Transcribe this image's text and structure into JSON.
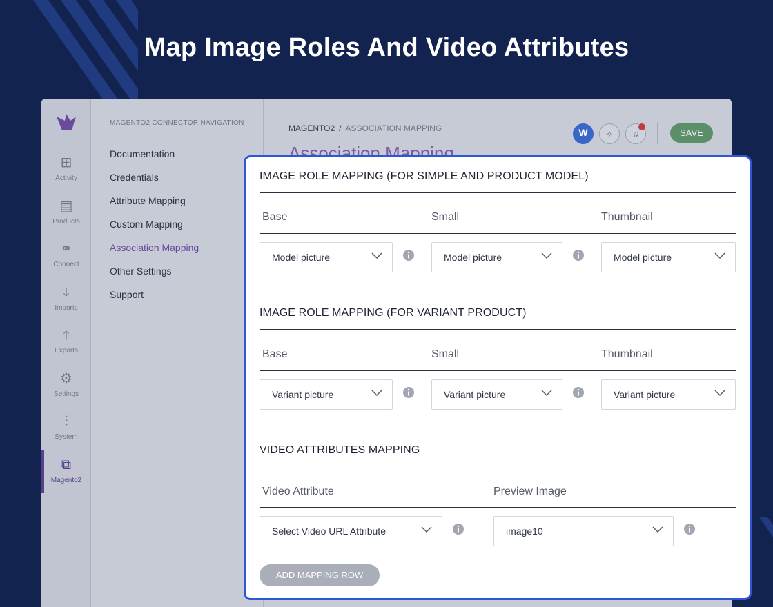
{
  "hero": {
    "title": "Map Image Roles And Video Attributes"
  },
  "iconbar": {
    "items": [
      {
        "label": "Activity",
        "icon": "activity-icon"
      },
      {
        "label": "Products",
        "icon": "products-icon"
      },
      {
        "label": "Connect",
        "icon": "connect-icon"
      },
      {
        "label": "Imports",
        "icon": "imports-icon"
      },
      {
        "label": "Exports",
        "icon": "exports-icon"
      },
      {
        "label": "Settings",
        "icon": "settings-icon"
      },
      {
        "label": "System",
        "icon": "system-icon"
      },
      {
        "label": "Magento2",
        "icon": "magento2-icon"
      }
    ]
  },
  "subnav": {
    "title": "MAGENTO2 CONNECTOR NAVIGATION",
    "items": [
      "Documentation",
      "Credentials",
      "Attribute Mapping",
      "Custom Mapping",
      "Association Mapping",
      "Other Settings",
      "Support"
    ],
    "active": "Association Mapping"
  },
  "header": {
    "crumb_root": "MAGENTO2",
    "crumb_sep": "/",
    "crumb_current": "ASSOCIATION MAPPING",
    "page_title": "Association Mapping",
    "badge_letter": "W",
    "save_label": "SAVE"
  },
  "card": {
    "section1": {
      "title": "IMAGE ROLE MAPPING (FOR SIMPLE AND PRODUCT MODEL)",
      "columns": [
        "Base",
        "Small",
        "Thumbnail"
      ],
      "values": [
        "Model picture",
        "Model picture",
        "Model picture"
      ]
    },
    "section2": {
      "title": "IMAGE ROLE MAPPING (FOR VARIANT PRODUCT)",
      "columns": [
        "Base",
        "Small",
        "Thumbnail"
      ],
      "values": [
        "Variant picture",
        "Variant picture",
        "Variant picture"
      ]
    },
    "section3": {
      "title": "VIDEO ATTRIBUTES MAPPING",
      "columns": [
        "Video Attribute",
        "Preview Image"
      ],
      "values": [
        "Select Video URL Attribute",
        "image10"
      ]
    },
    "add_row_label": "ADD MAPPING ROW"
  },
  "colors": {
    "accent": "#2f56d6",
    "save": "#5b8f6a",
    "bg": "#13234f"
  }
}
